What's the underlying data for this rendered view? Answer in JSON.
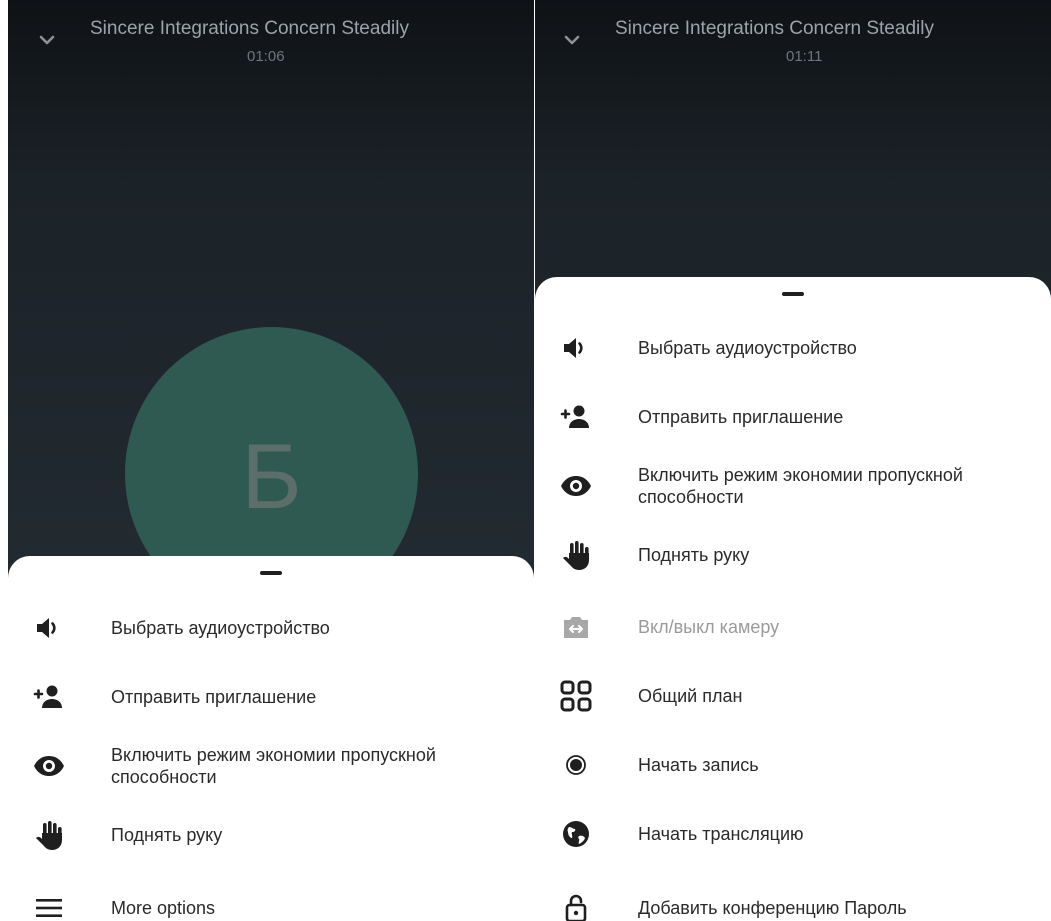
{
  "left": {
    "call": {
      "title": "Sincere Integrations Concern Steadily",
      "timer": "01:06",
      "avatar_letter": "Б"
    },
    "menu": [
      {
        "label": "Выбрать аудиоустройство",
        "icon": "volume-icon"
      },
      {
        "label": "Отправить приглашение",
        "icon": "add-person-icon"
      },
      {
        "label": "Включить режим экономии пропускной способности",
        "icon": "eye-icon"
      },
      {
        "label": "Поднять руку",
        "icon": "hand-icon"
      },
      {
        "label": "More options",
        "icon": "menu-icon"
      }
    ]
  },
  "right": {
    "call": {
      "title": "Sincere Integrations Concern Steadily",
      "timer": "01:11"
    },
    "menu": [
      {
        "label": "Выбрать аудиоустройство",
        "icon": "volume-icon"
      },
      {
        "label": "Отправить приглашение",
        "icon": "add-person-icon"
      },
      {
        "label": "Включить режим экономии пропускной способности",
        "icon": "eye-icon"
      },
      {
        "label": "Поднять руку",
        "icon": "hand-icon"
      },
      {
        "label": "Вкл/выкл камеру",
        "icon": "switch-camera-icon",
        "disabled": true
      },
      {
        "label": "Общий план",
        "icon": "grid-view-icon"
      },
      {
        "label": "Начать запись",
        "icon": "record-icon"
      },
      {
        "label": "Начать трансляцию",
        "icon": "globe-icon"
      },
      {
        "label": "Добавить конференцию Пароль",
        "icon": "lock-open-icon"
      }
    ]
  },
  "colors": {
    "call_background": "#222a31",
    "avatar": "#2e5a52",
    "sheet": "#ffffff",
    "text": "#2a2a2a",
    "disabled_text": "#9a9a9a"
  }
}
